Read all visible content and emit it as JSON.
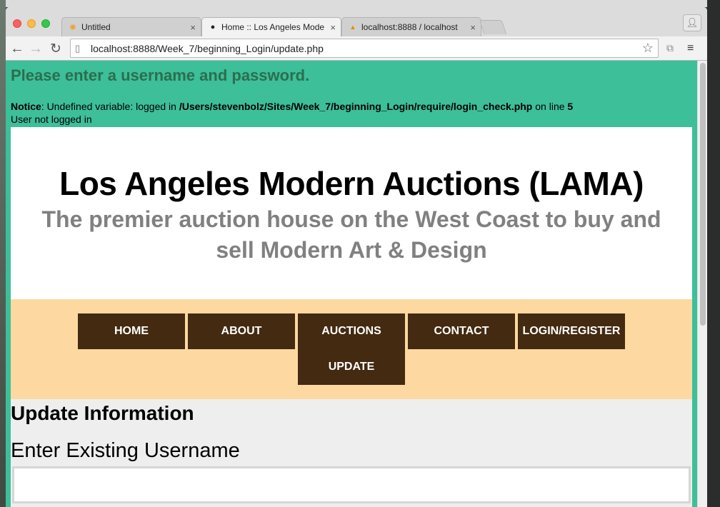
{
  "browser": {
    "tabs": [
      {
        "label": "Untitled",
        "favicon": "pinwheel-icon",
        "active": false
      },
      {
        "label": "Home :: Los Angeles Mode",
        "favicon": "github-icon",
        "active": true
      },
      {
        "label": "localhost:8888 / localhost",
        "favicon": "phpmyadmin-icon",
        "active": false
      }
    ],
    "url": "localhost:8888/Week_7/beginning_Login/update.php"
  },
  "page": {
    "login_message": "Please enter a username and password.",
    "notice": {
      "label": "Notice",
      "text": ": Undefined variable: logged in ",
      "path": "/Users/stevenbolz/Sites/Week_7/beginning_Login/require/login_check.php",
      "line_text": " on line ",
      "line_number": "5"
    },
    "not_logged_in": "User not logged in",
    "header": {
      "title": "Los Angeles Modern Auctions (LAMA)",
      "subtitle": "The premier auction house on the West Coast to buy and sell Modern Art & Design"
    },
    "nav": {
      "home": "HOME",
      "about": "ABOUT",
      "auctions": "AUCTIONS",
      "contact": "CONTACT",
      "login": "LOGIN/REGISTER",
      "update": "UPDATE"
    },
    "content": {
      "heading": "Update Information",
      "username_label": "Enter Existing Username",
      "username_value": ""
    }
  },
  "colors": {
    "page_background": "#3dbf99",
    "nav_background": "#fdd9a1",
    "nav_item": "#432a11",
    "subtitle": "#808080",
    "login_message": "#2b6e4f"
  }
}
